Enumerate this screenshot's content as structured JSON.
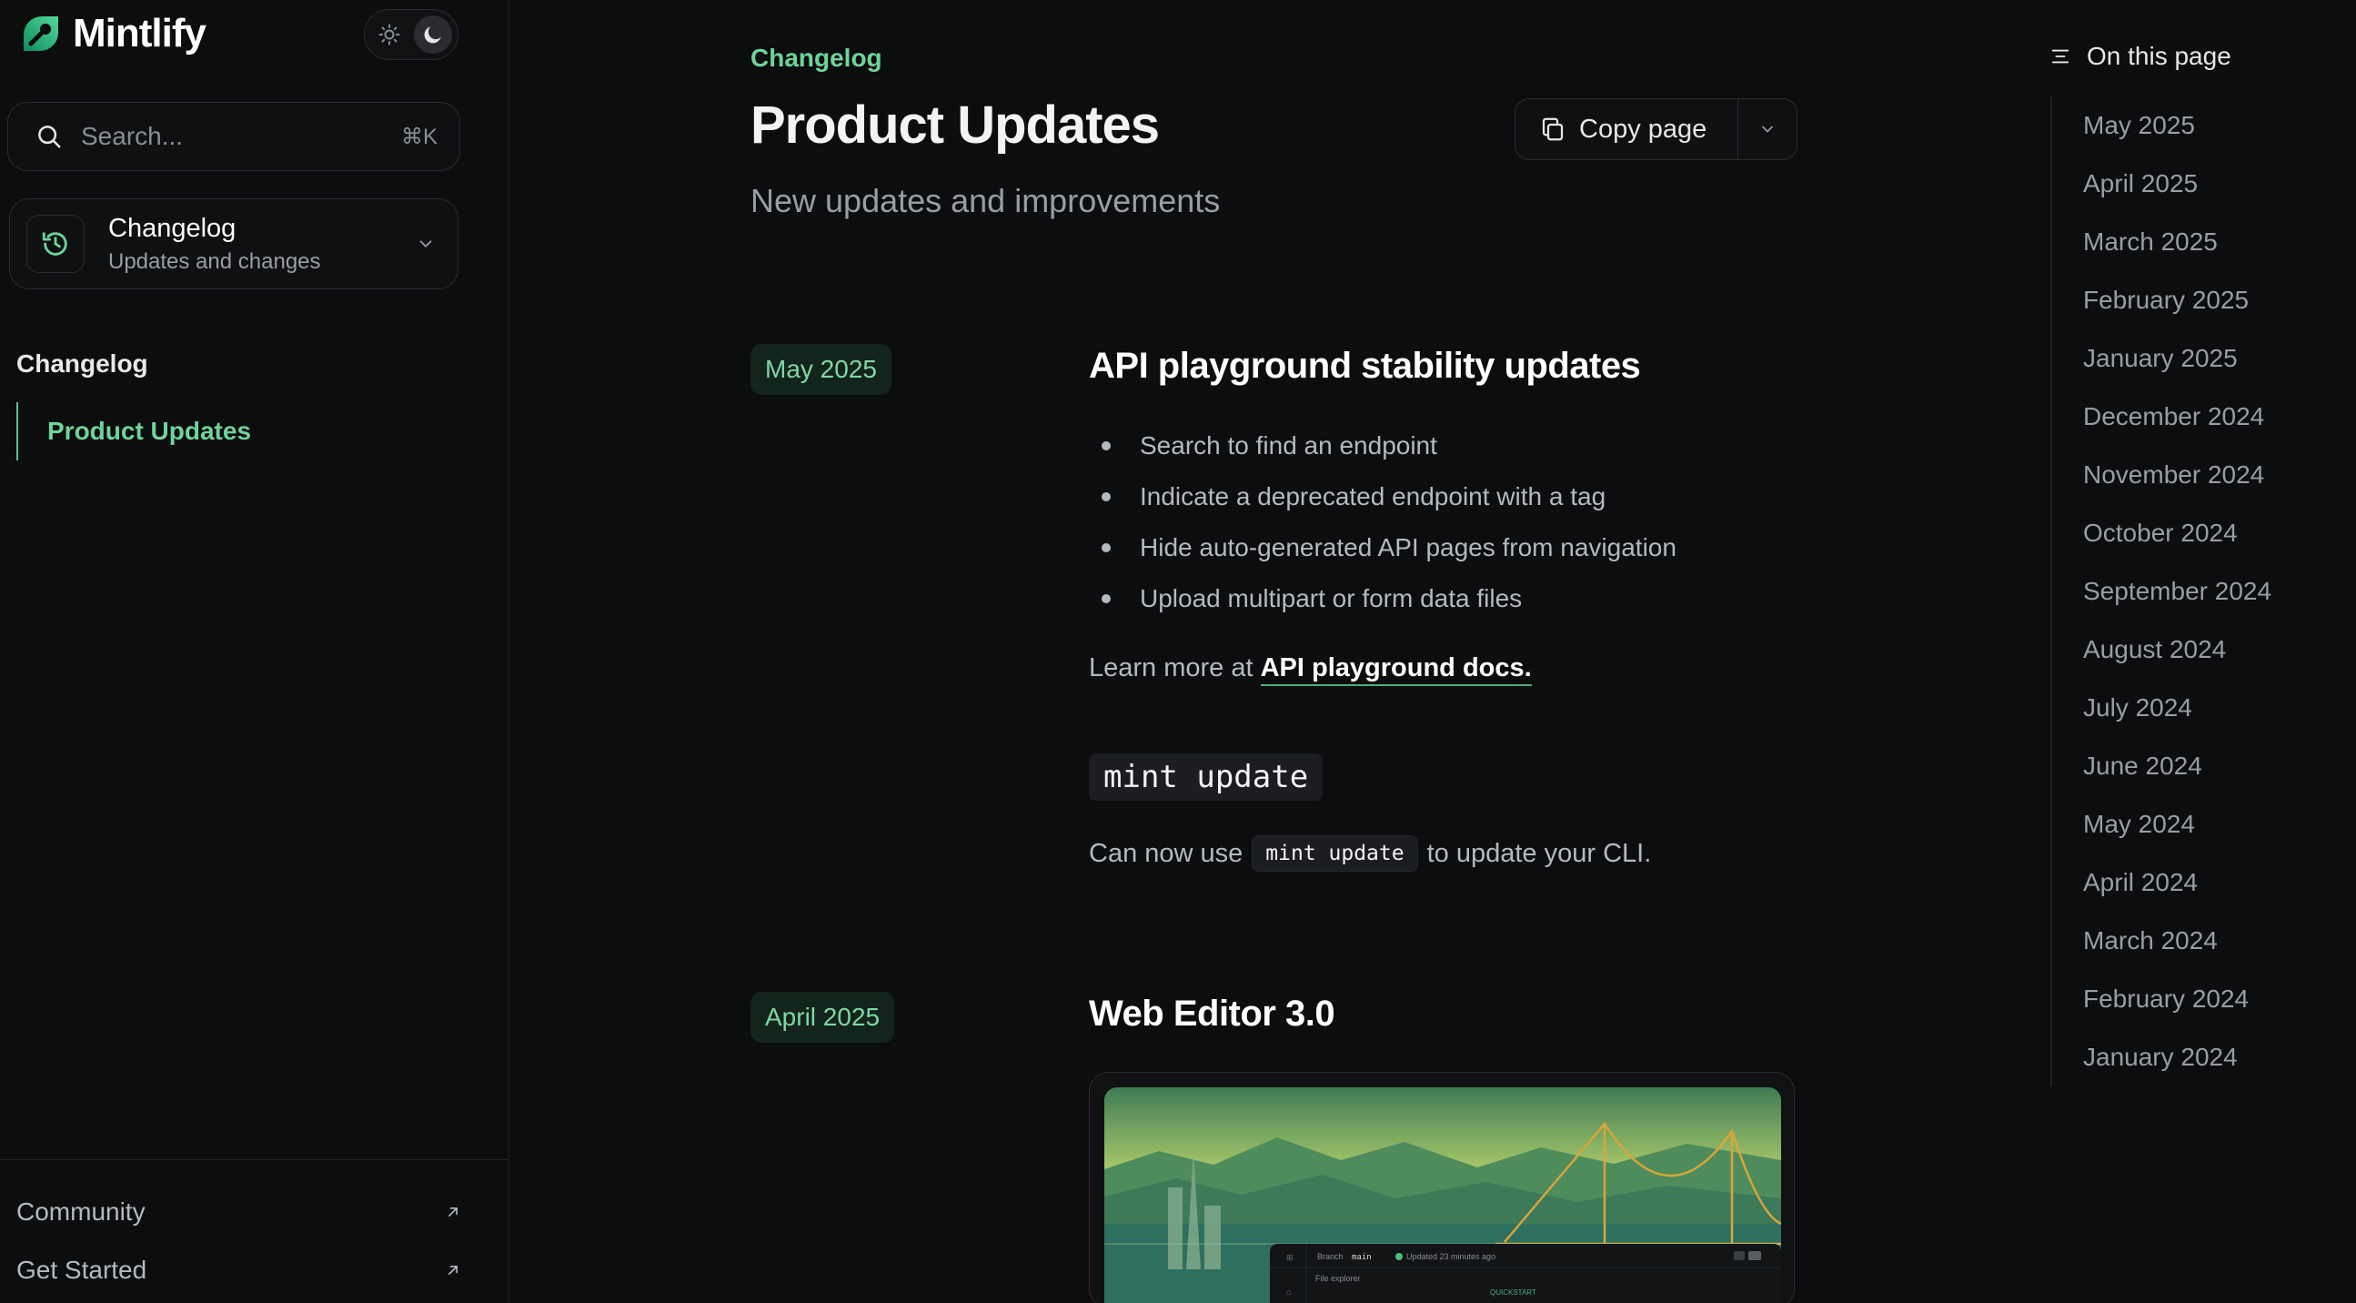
{
  "app": {
    "brand": "Mintlify"
  },
  "sidebar": {
    "search": {
      "placeholder": "Search...",
      "shortcut": "⌘K"
    },
    "section": {
      "title": "Changelog",
      "subtitle": "Updates and changes"
    },
    "nav_heading": "Changelog",
    "nav_items": [
      {
        "label": "Product Updates",
        "active": true
      }
    ],
    "footer_links": [
      {
        "label": "Community"
      },
      {
        "label": "Get Started"
      }
    ]
  },
  "page": {
    "eyebrow": "Changelog",
    "title": "Product Updates",
    "subtitle": "New updates and improvements",
    "copy_label": "Copy page"
  },
  "entries": [
    {
      "date": "May 2025",
      "title": "API playground stability updates",
      "bullets": [
        "Search to find an endpoint",
        "Indicate a deprecated endpoint with a tag",
        "Hide auto-generated API pages from navigation",
        "Upload multipart or form data files"
      ],
      "learn_more_prefix": "Learn more at",
      "learn_more_link": "API playground docs.",
      "code_heading": "mint update",
      "code_line_before": "Can now use",
      "code_inline": "mint update",
      "code_line_after": "to update your CLI."
    },
    {
      "date": "April 2025",
      "title": "Web Editor 3.0",
      "preview": {
        "branch_label": "Branch",
        "branch_name": "main",
        "updated": "Updated 23 minutes ago",
        "file_explorer": "File explorer",
        "quickstart": "QUICKSTART"
      }
    }
  ],
  "toc": {
    "heading": "On this page",
    "items": [
      "May 2025",
      "April 2025",
      "March 2025",
      "February 2025",
      "January 2025",
      "December 2024",
      "November 2024",
      "October 2024",
      "September 2024",
      "August 2024",
      "July 2024",
      "June 2024",
      "May 2024",
      "April 2024",
      "March 2024",
      "February 2024",
      "January 2024"
    ]
  },
  "colors": {
    "background": "#0c0d0e",
    "accent": "#6fd39a",
    "badge_bg": "#12241b",
    "text_muted": "#9a9da2"
  }
}
